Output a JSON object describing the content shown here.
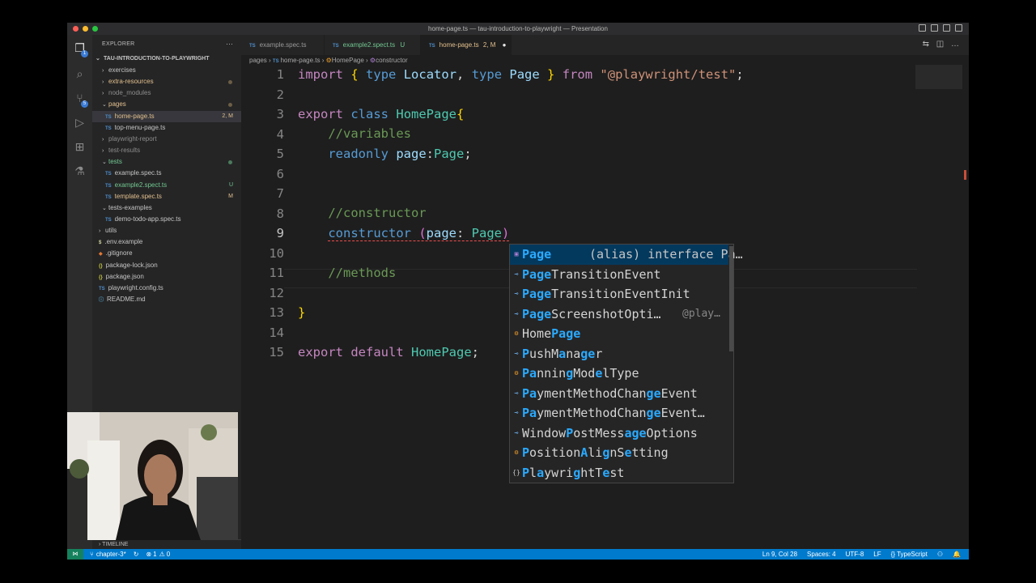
{
  "window": {
    "title": "home-page.ts — tau-introduction-to-playwright — Presentation"
  },
  "colors": {
    "accent": "#007acc",
    "keyword": "#c586c0",
    "type": "#4ec9b0",
    "comment": "#6a9955",
    "string": "#ce9178"
  },
  "activity": {
    "explorer_badge": "1",
    "scm_badge": "5"
  },
  "explorer": {
    "header": "EXPLORER",
    "more": "···",
    "root": "TAU-INTRODUCTION-TO-PLAYWRIGHT",
    "items": [
      {
        "label": "exercises",
        "type": "folder",
        "color": "#c5c5c5"
      },
      {
        "label": "extra-resources",
        "type": "folder",
        "color": "#e2c08d"
      },
      {
        "label": "node_modules",
        "type": "folder",
        "color": "#8c8c8c"
      },
      {
        "label": "pages",
        "type": "folder-open",
        "color": "#e2c08d"
      },
      {
        "label": "home-page.ts",
        "type": "ts",
        "color": "#e2c08d",
        "badge": "2, M"
      },
      {
        "label": "top-menu-page.ts",
        "type": "ts",
        "color": "#c5c5c5"
      },
      {
        "label": "playwright-report",
        "type": "folder",
        "color": "#8c8c8c"
      },
      {
        "label": "test-results",
        "type": "folder",
        "color": "#8c8c8c"
      },
      {
        "label": "tests",
        "type": "folder-open",
        "color": "#73c991"
      },
      {
        "label": "example.spec.ts",
        "type": "ts",
        "color": "#c5c5c5"
      },
      {
        "label": "example2.spect.ts",
        "type": "ts",
        "color": "#73c991",
        "badge": "U"
      },
      {
        "label": "template.spec.ts",
        "type": "ts",
        "color": "#e2c08d",
        "badge": "M"
      },
      {
        "label": "tests-examples",
        "type": "folder-open",
        "color": "#c5c5c5"
      },
      {
        "label": "demo-todo-app.spec.ts",
        "type": "ts",
        "color": "#c5c5c5"
      },
      {
        "label": "utils",
        "type": "folder",
        "color": "#c5c5c5"
      },
      {
        "label": ".env.example",
        "type": "env",
        "color": "#c5c5c5"
      },
      {
        "label": ".gitignore",
        "type": "git",
        "color": "#c5c5c5"
      },
      {
        "label": "package-lock.json",
        "type": "json",
        "color": "#c5c5c5"
      },
      {
        "label": "package.json",
        "type": "json",
        "color": "#c5c5c5"
      },
      {
        "label": "playwright.config.ts",
        "type": "ts",
        "color": "#c5c5c5"
      },
      {
        "label": "README.md",
        "type": "info",
        "color": "#c5c5c5"
      }
    ],
    "timeline": "TIMELINE"
  },
  "tabs": [
    {
      "label": "example.spec.ts",
      "badge": "",
      "active": false
    },
    {
      "label": "example2.spect.ts",
      "badge": "U",
      "active": false
    },
    {
      "label": "home-page.ts",
      "badge": "2, M",
      "active": true
    }
  ],
  "breadcrumb": [
    "pages",
    "home-page.ts",
    "HomePage",
    "constructor"
  ],
  "editor": {
    "line_numbers": [
      "1",
      "2",
      "3",
      "4",
      "5",
      "6",
      "7",
      "8",
      "9",
      "10",
      "11",
      "12",
      "13",
      "14",
      "15"
    ],
    "current_line": 9
  },
  "suggest": {
    "items": [
      {
        "label": "Page",
        "detail": "(alias) interface Pa…",
        "kind": "alias"
      },
      {
        "label": "PageTransitionEvent",
        "kind": "interface"
      },
      {
        "label": "PageTransitionEventInit",
        "kind": "interface"
      },
      {
        "label": "PageScreenshotOpti…",
        "detail": "@play…",
        "kind": "interface"
      },
      {
        "label": "HomePage",
        "kind": "class"
      },
      {
        "label": "PushManager",
        "kind": "interface"
      },
      {
        "label": "PanningModelType",
        "kind": "class"
      },
      {
        "label": "PaymentMethodChangeEvent",
        "kind": "interface"
      },
      {
        "label": "PaymentMethodChangeEvent…",
        "kind": "interface"
      },
      {
        "label": "WindowPostMessageOptions",
        "kind": "interface"
      },
      {
        "label": "PositionAlignSetting",
        "kind": "class"
      },
      {
        "label": "PlaywrightTest",
        "kind": "module"
      }
    ]
  },
  "status": {
    "branch": "chapter-3*",
    "errors": "1",
    "warnings": "0",
    "position": "Ln 9, Col 28",
    "spaces": "Spaces: 4",
    "encoding": "UTF-8",
    "eol": "LF",
    "language": "TypeScript"
  }
}
